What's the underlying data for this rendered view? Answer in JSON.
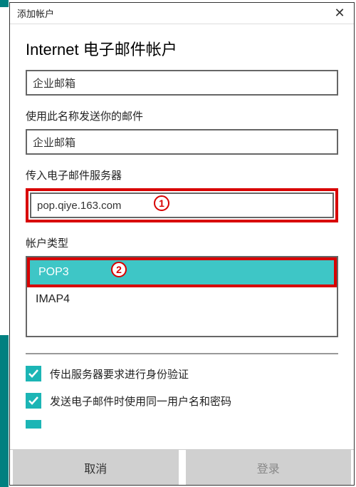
{
  "colors": {
    "accent": "#1cb5b5",
    "highlight": "#d80000",
    "selected_bg": "#3ec6c6"
  },
  "titlebar": {
    "title": "添加帐户"
  },
  "heading": "Internet 电子邮件帐户",
  "fields": {
    "account_name": {
      "value": "企业邮箱"
    },
    "send_name_label": "使用此名称发送你的邮件",
    "send_name": {
      "value": "企业邮箱"
    },
    "incoming_label": "传入电子邮件服务器",
    "incoming": {
      "value": "pop.qiye.163.com"
    },
    "type_label": "帐户类型",
    "type_options": {
      "selected": "POP3",
      "other": "IMAP4"
    }
  },
  "markers": {
    "m1": "1",
    "m2": "2"
  },
  "checkboxes": {
    "auth_required": "传出服务器要求进行身份验证",
    "same_credentials": "发送电子邮件时使用同一用户名和密码"
  },
  "buttons": {
    "cancel": "取消",
    "login": "登录"
  }
}
